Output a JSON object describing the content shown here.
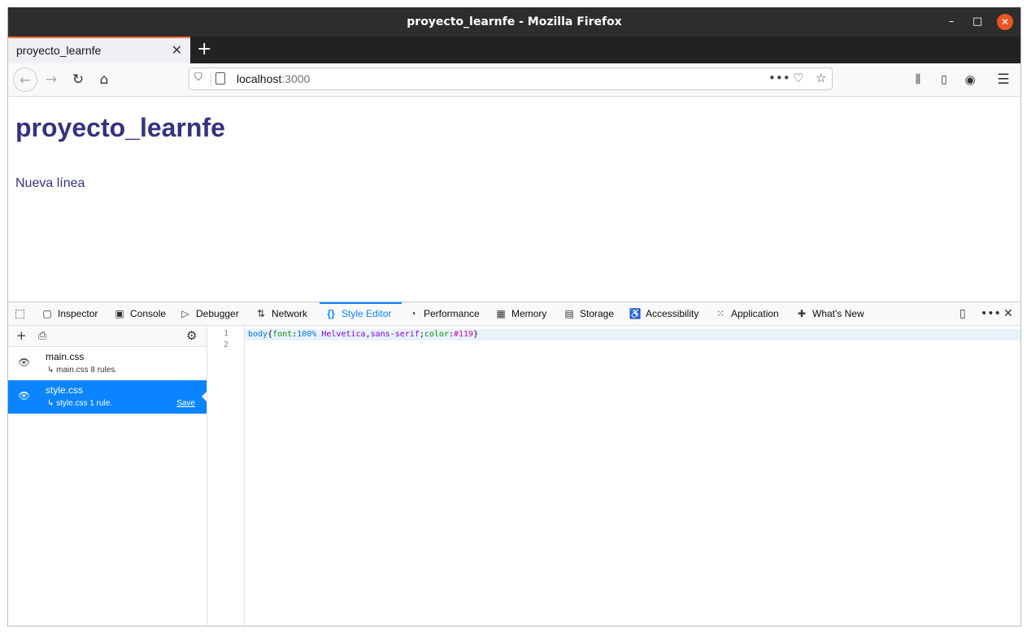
{
  "window": {
    "title": "proyecto_learnfe - Mozilla Firefox"
  },
  "tab": {
    "label": "proyecto_learnfe"
  },
  "navbar": {
    "url_host": "localhost",
    "url_port": ":3000"
  },
  "page": {
    "heading": "proyecto_learnfe",
    "paragraph": "Nueva línea"
  },
  "devtools": {
    "tabs": [
      {
        "label": "Inspector",
        "icon": "inspector-icon"
      },
      {
        "label": "Console",
        "icon": "console-icon"
      },
      {
        "label": "Debugger",
        "icon": "debugger-icon"
      },
      {
        "label": "Network",
        "icon": "network-icon"
      },
      {
        "label": "Style Editor",
        "icon": "style-editor-icon",
        "active": true
      },
      {
        "label": "Performance",
        "icon": "performance-icon"
      },
      {
        "label": "Memory",
        "icon": "memory-icon"
      },
      {
        "label": "Storage",
        "icon": "storage-icon"
      },
      {
        "label": "Accessibility",
        "icon": "accessibility-icon"
      },
      {
        "label": "Application",
        "icon": "application-icon"
      },
      {
        "label": "What's New",
        "icon": "whats-new-icon"
      }
    ],
    "stylesheets": [
      {
        "name": "main.css",
        "rules": "↳ main.css 8 rules."
      },
      {
        "name": "style.css",
        "rules": "↳ style.css 1 rule.",
        "save": "Save",
        "selected": true
      }
    ],
    "editor": {
      "line_numbers": [
        "1",
        "2"
      ],
      "tokens": {
        "selector": "body",
        "open": "{",
        "prop1": "font",
        "colon1": ":",
        "num": "100%",
        "font_family": " Helvetica",
        "comma": ",",
        "generic": "sans-serif",
        "semi": ";",
        "prop2": "color",
        "colon2": ":",
        "color_value": "#119",
        "close": "}"
      }
    }
  },
  "colors": {
    "accent": "#0a84ff",
    "tab_highlight": "#ff7139",
    "close_button": "#e95420",
    "page_text": "#33337f"
  }
}
